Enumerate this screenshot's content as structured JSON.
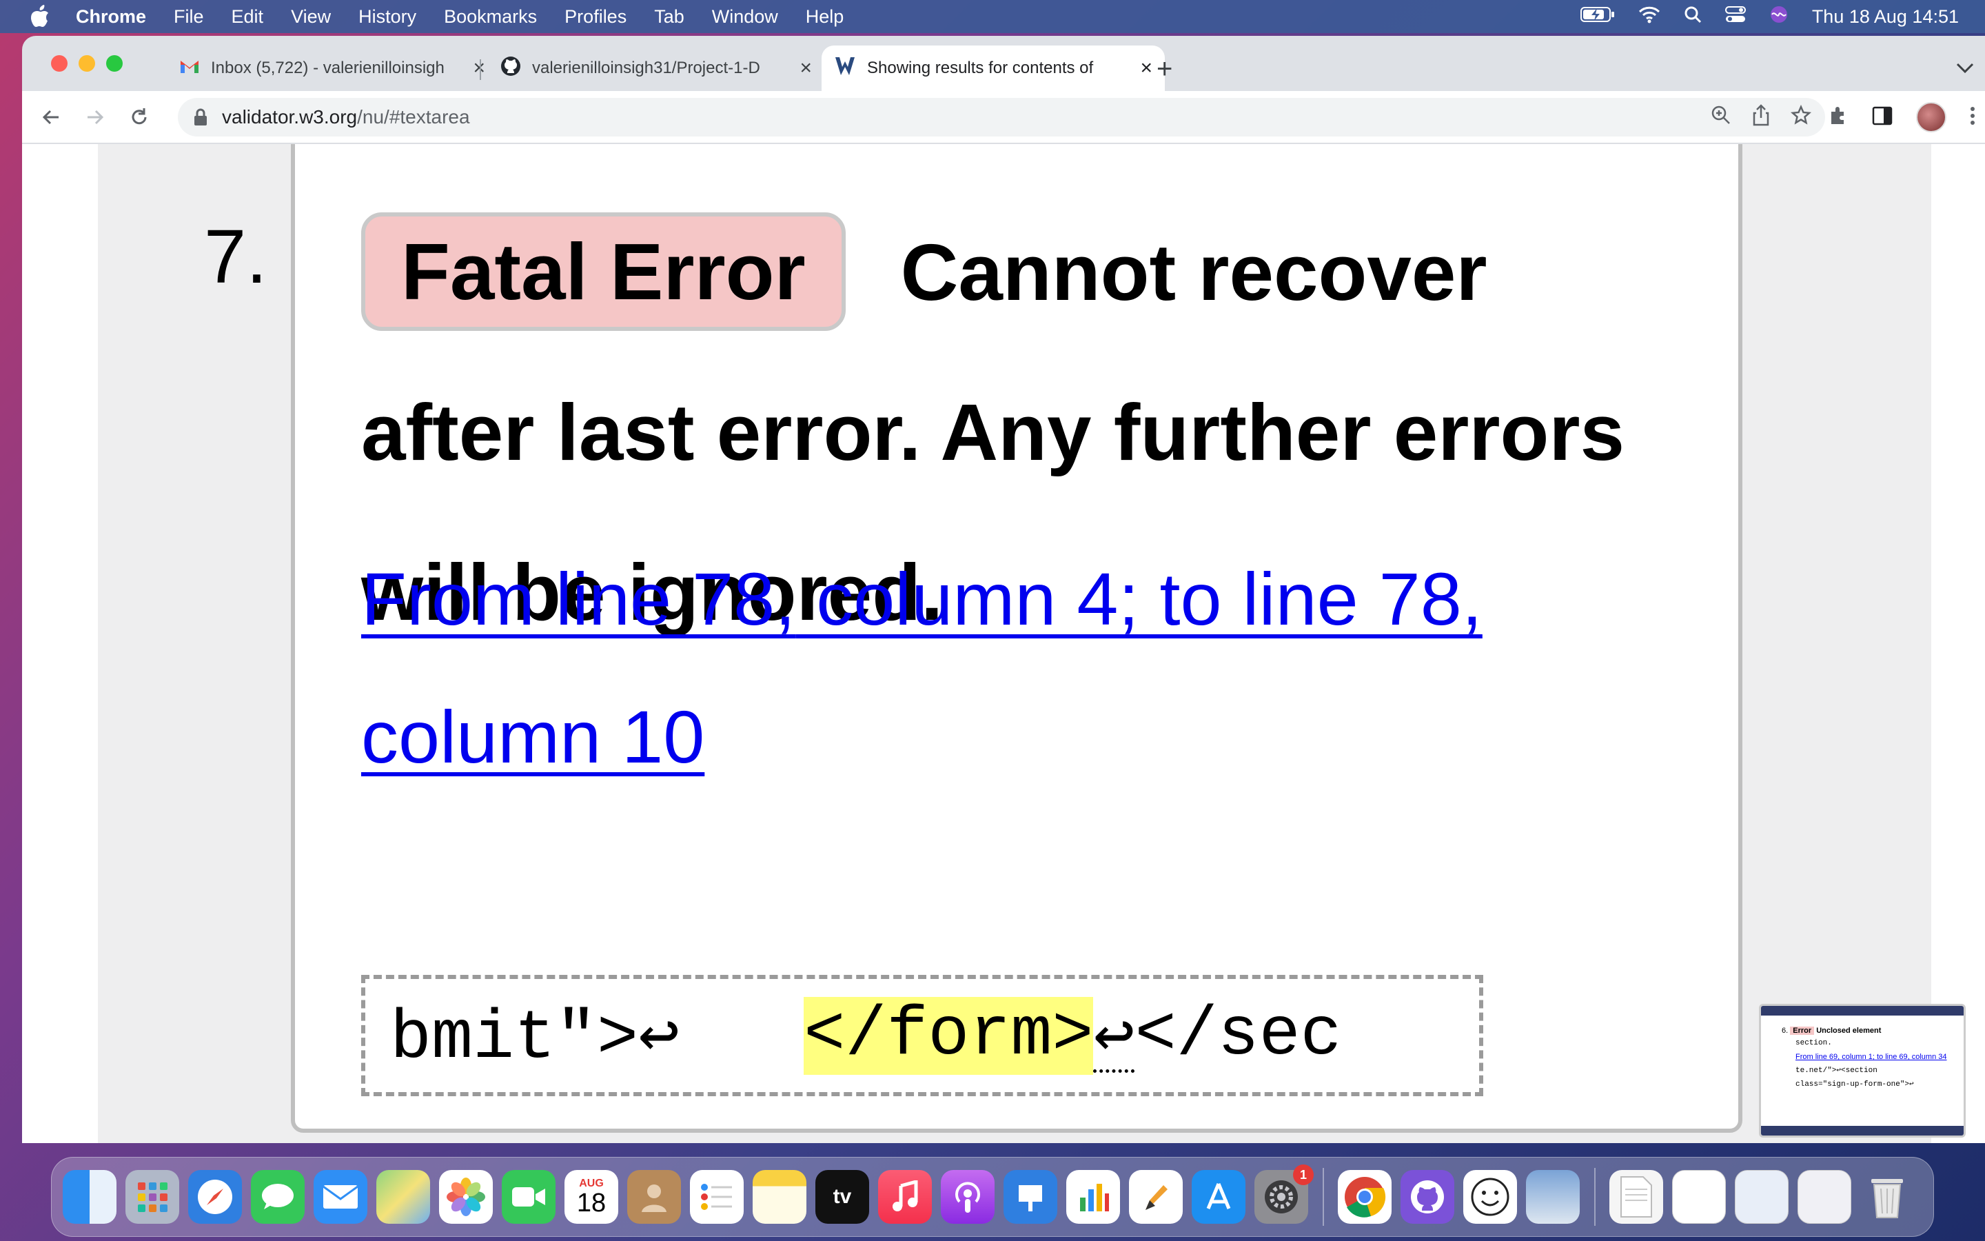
{
  "menubar": {
    "app_name": "Chrome",
    "items": [
      "File",
      "Edit",
      "View",
      "History",
      "Bookmarks",
      "Profiles",
      "Tab",
      "Window",
      "Help"
    ],
    "clock": "Thu 18 Aug  14:51"
  },
  "tabs": [
    {
      "title": "Inbox (5,722) - valerienilloinsigh",
      "icon": "gmail-icon"
    },
    {
      "title": "valerienilloinsigh31/Project-1-D",
      "icon": "github-icon"
    },
    {
      "title": "Showing results for contents of",
      "icon": "w3c-validator-icon",
      "active": true
    }
  ],
  "address_bar": {
    "domain": "validator.w3.org",
    "path": "/nu/#textarea"
  },
  "result": {
    "number": "7.",
    "badge": "Fatal Error",
    "message": "Cannot recover after last error. Any further errors will be ignored.",
    "location": {
      "part1": "From line 78,",
      "part2": " column 4;",
      "part3": " to line 78,",
      "part4": "column 10"
    },
    "extract": {
      "before": "bmit\">↩",
      "gap": "   ",
      "highlight": "</form>",
      "after_mark": "↩",
      "after": "</sec"
    }
  },
  "thumbnail": {
    "num": "6.",
    "badge": "Error",
    "title": "Unclosed element",
    "code1": "section.",
    "link": "From line 69, column 1; to line 69, column 34",
    "code2": "te.net/\">↩<section",
    "code3": "class=\"sign-up-form-one\">↩"
  },
  "dock": {
    "calendar_month": "AUG",
    "calendar_day": "18",
    "settings_badge": "1",
    "tv_label": "tv"
  },
  "colors": {
    "link": "#0000ee",
    "fatal_badge": "#f5c6c6",
    "highlight": "#ffff80"
  }
}
